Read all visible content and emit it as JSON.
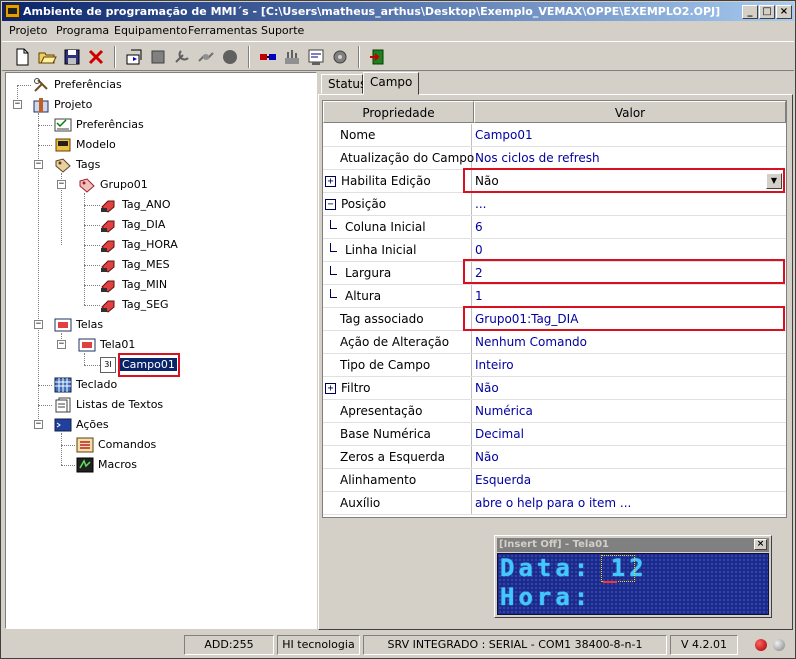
{
  "window": {
    "title": "Ambiente de programação de MMI´s - [C:\\Users\\matheus_arthus\\Desktop\\Exemplo_VEMAX\\OPPE\\EXEMPLO2.OPJ]",
    "minimize": "_",
    "maximize": "□",
    "close": "×"
  },
  "menu": [
    "Projeto",
    "Programa",
    "Equipamento",
    "Ferramentas",
    "Suporte"
  ],
  "tree": {
    "preferencias_root": "Preferências",
    "projeto": "Projeto",
    "preferencias": "Preferências",
    "modelo": "Modelo",
    "tags": "Tags",
    "grupo01": "Grupo01",
    "tag_items": [
      "Tag_ANO",
      "Tag_DIA",
      "Tag_HORA",
      "Tag_MES",
      "Tag_MIN",
      "Tag_SEG"
    ],
    "telas": "Telas",
    "tela01": "Tela01",
    "campo01": "Campo01",
    "campo_icon_text": "3I",
    "teclado": "Teclado",
    "listas": "Listas de Textos",
    "acoes": "Ações",
    "comandos": "Comandos",
    "macros": "Macros"
  },
  "tabs": [
    "Status",
    "Campo"
  ],
  "grid": {
    "header_prop": "Propriedade",
    "header_val": "Valor",
    "rows": [
      {
        "name": "Nome",
        "value": "Campo01"
      },
      {
        "name": "Atualização do Campo",
        "value": "Nos ciclos de refresh"
      },
      {
        "name": "Habilita Edição",
        "value": "Não"
      },
      {
        "name": "Posição",
        "value": "..."
      },
      {
        "name": "Coluna Inicial",
        "value": "6"
      },
      {
        "name": "Linha Inicial",
        "value": "0"
      },
      {
        "name": "Largura",
        "value": "2"
      },
      {
        "name": "Altura",
        "value": "1"
      },
      {
        "name": "Tag associado",
        "value": "Grupo01:Tag_DIA"
      },
      {
        "name": "Ação de Alteração",
        "value": "Nenhum Comando"
      },
      {
        "name": "Tipo de Campo",
        "value": "Inteiro"
      },
      {
        "name": "Filtro",
        "value": "Não"
      },
      {
        "name": "Apresentação",
        "value": "Numérica"
      },
      {
        "name": "Base Numérica",
        "value": "Decimal"
      },
      {
        "name": "Zeros a Esquerda",
        "value": "Não"
      },
      {
        "name": "Alinhamento",
        "value": "Esquerda"
      },
      {
        "name": "Auxílio",
        "value": "abre o help para o item ..."
      }
    ],
    "expand_plus": "+",
    "expand_minus": "−",
    "dropdown_arrow": "▼"
  },
  "preview": {
    "title": "[Insert Off] - Tela01",
    "close": "×",
    "line1": "Data: 12",
    "line2": "Hora:"
  },
  "status": {
    "add": "ADD:255",
    "company": "HI tecnologia",
    "connection": "SRV INTEGRADO : SERIAL - COM1 38400-8-n-1",
    "version": "V 4.2.01"
  },
  "colors": {
    "title_start": "#0a246a",
    "title_end": "#a6caf0",
    "highlight": "#d81020",
    "value_text": "#0000a0",
    "lcd_bg": "#1a2a8a",
    "lcd_text": "#40c8ff",
    "led_red": "#c00000",
    "led_gray": "#a0a0a0"
  },
  "icons": [
    "new-file-icon",
    "open-folder-icon",
    "save-icon",
    "delete-icon",
    "copy-to-device-icon",
    "stop-icon",
    "tool-icon",
    "connect-icon",
    "record-icon",
    "transfer-icon",
    "network-icon",
    "compile-icon",
    "gear-icon",
    "exit-icon"
  ]
}
